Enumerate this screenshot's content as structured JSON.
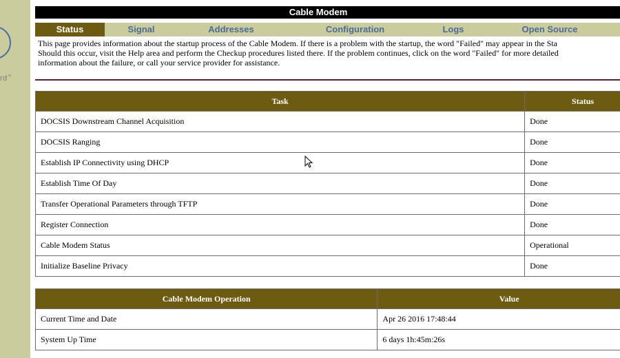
{
  "sidebar": {
    "logo_text": "rd",
    "logo_mark": "™"
  },
  "header": {
    "title": "Cable Modem"
  },
  "tabs": [
    {
      "label": "Status",
      "active": true
    },
    {
      "label": "Signal",
      "active": false
    },
    {
      "label": "Addresses",
      "active": false
    },
    {
      "label": "Configuration",
      "active": false
    },
    {
      "label": "Logs",
      "active": false
    },
    {
      "label": "Open Source",
      "active": false
    }
  ],
  "intro": {
    "lines": [
      "This page provides information about the startup process of the Cable Modem. If there is a problem with the startup, the word \"Failed\" may appear in the Sta",
      "Should this occur, visit the Help area and perform the Checkup procedures listed there. If the problem continues, click on the word \"Failed\" for more detailed",
      "information about the failure, or call your service provider for assistance."
    ]
  },
  "task_table": {
    "headers": [
      "Task",
      "Status"
    ],
    "rows": [
      [
        "DOCSIS Downstream Channel Acquisition",
        "Done"
      ],
      [
        "DOCSIS Ranging",
        "Done"
      ],
      [
        "Establish IP Connectivity using DHCP",
        "Done"
      ],
      [
        "Establish Time Of Day",
        "Done"
      ],
      [
        "Transfer Operational Parameters through TFTP",
        "Done"
      ],
      [
        "Register Connection",
        "Done"
      ],
      [
        "Cable Modem Status",
        "Operational"
      ],
      [
        "Initialize Baseline Privacy",
        "Done"
      ]
    ]
  },
  "operation_table": {
    "headers": [
      "Cable Modem Operation",
      "Value"
    ],
    "rows": [
      [
        "Current Time and Date",
        "Apr 26 2016 17:48:44"
      ],
      [
        "System Up Time",
        "6 days 1h:45m:26s"
      ]
    ]
  },
  "colors": {
    "sidebar_bg": "#cbcc9e",
    "tab_active_bg": "#6c5b10",
    "tab_text": "#4a6b9a",
    "header_bg": "#000000",
    "divider": "#6e1830",
    "table_header_bg": "#6c5b10"
  },
  "icons": {
    "cursor": "mouse-pointer-icon",
    "logo": "brand-logo-icon"
  }
}
